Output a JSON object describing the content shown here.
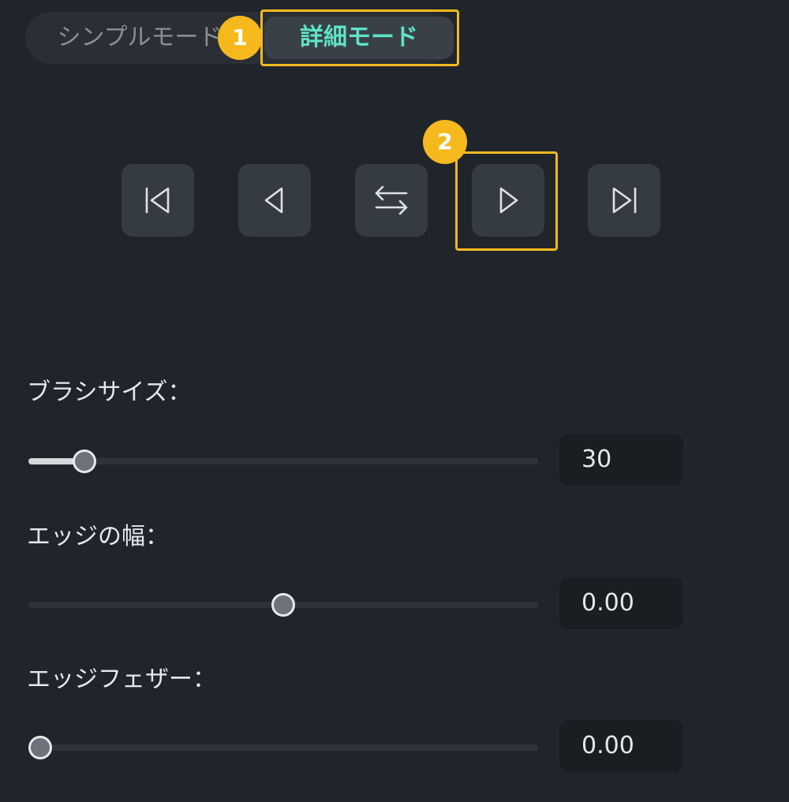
{
  "mode_switch": {
    "simple_label": "シンプルモード",
    "advanced_label": "詳細モード",
    "selected": "advanced"
  },
  "annotations": {
    "badge_1": "1",
    "badge_2": "2",
    "highlight_color": "#f5b81d"
  },
  "playback": {
    "buttons": [
      {
        "icon": "skip-to-first-icon"
      },
      {
        "icon": "step-back-icon"
      },
      {
        "icon": "swap-icon"
      },
      {
        "icon": "play-icon"
      },
      {
        "icon": "skip-to-last-icon"
      }
    ]
  },
  "settings": {
    "brush_size": {
      "label": "ブラシサイズ：",
      "value": "30",
      "level": 0.11
    },
    "edge_width": {
      "label": "エッジの幅：",
      "value": "0.00",
      "level": 0.5
    },
    "edge_feather": {
      "label": "エッジフェザー：",
      "value": "0.00",
      "level": 0.0
    }
  },
  "colors": {
    "background": "#20252c",
    "accent": "#5fe3c6",
    "button_bg": "#353b43"
  }
}
